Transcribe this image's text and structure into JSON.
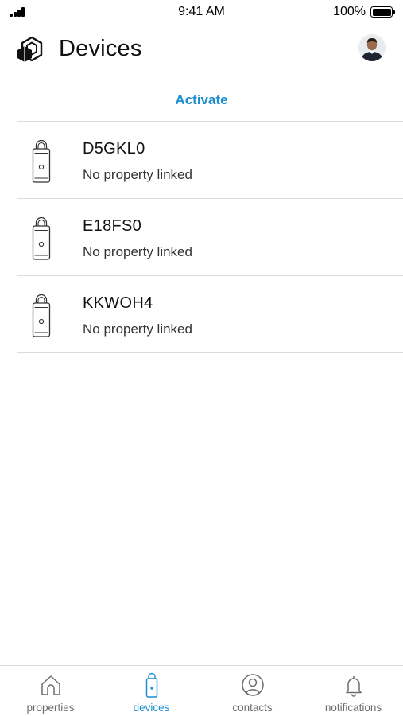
{
  "status_bar": {
    "time": "9:41 AM",
    "battery": "100%"
  },
  "header": {
    "title": "Devices"
  },
  "activate_label": "Activate",
  "devices": [
    {
      "id": "D5GKL0",
      "status": "No property linked"
    },
    {
      "id": "E18FS0",
      "status": "No property linked"
    },
    {
      "id": "KKWOH4",
      "status": "No property linked"
    }
  ],
  "tabs": [
    {
      "label": "properties",
      "icon": "home-icon",
      "active": false
    },
    {
      "label": "devices",
      "icon": "lockbox-icon",
      "active": true
    },
    {
      "label": "contacts",
      "icon": "contact-icon",
      "active": false
    },
    {
      "label": "notifications",
      "icon": "bell-icon",
      "active": false
    }
  ],
  "colors": {
    "accent": "#1b8fd0",
    "text": "#111111",
    "muted": "#6c6c6c",
    "divider": "#dcdcdc"
  }
}
